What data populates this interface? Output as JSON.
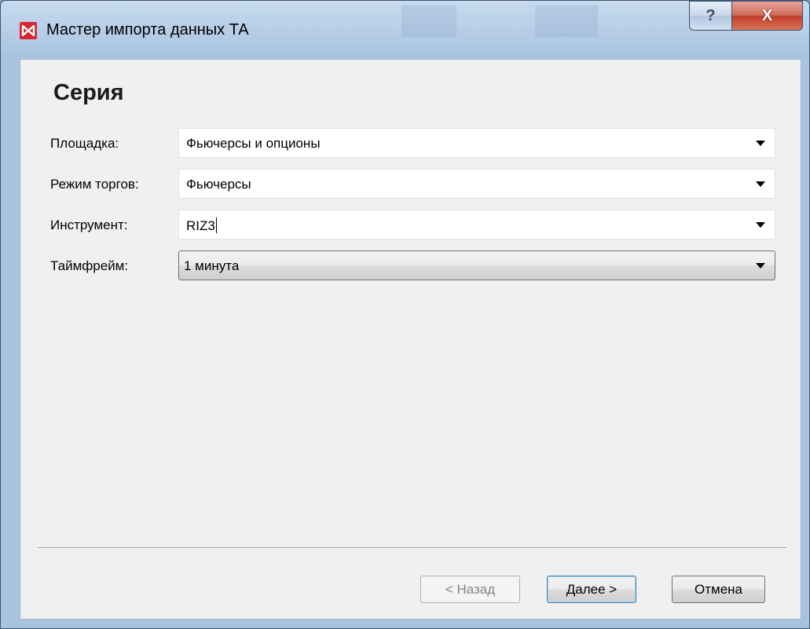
{
  "window": {
    "title": "Мастер импорта данных ТА",
    "help_glyph": "?",
    "close_glyph": "X"
  },
  "page": {
    "title": "Серия"
  },
  "fields": [
    {
      "label": "Площадка:",
      "value": "Фьючерсы и опционы"
    },
    {
      "label": "Режим торгов:",
      "value": "Фьючерсы"
    },
    {
      "label": "Инструмент:",
      "value": "RIZ3"
    },
    {
      "label": "Таймфрейм:",
      "value": "1 минута"
    }
  ],
  "buttons": {
    "back": "< Назад",
    "next": "Далее >",
    "cancel": "Отмена"
  },
  "colors": {
    "brand": "#d7262f",
    "close": "#c23c2a"
  },
  "icons": {
    "app": "moex-logo-icon",
    "help": "help-icon",
    "close": "close-icon",
    "dropdown": "chevron-down-icon"
  }
}
